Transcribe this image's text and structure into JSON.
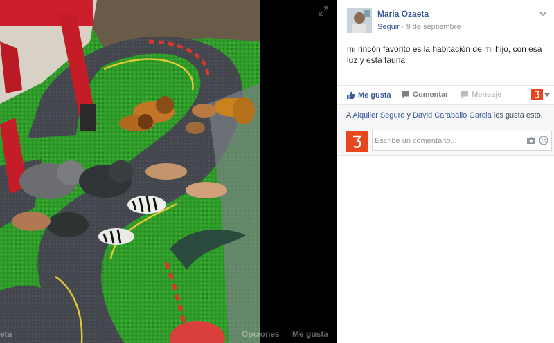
{
  "post": {
    "author": "Maria Ozaeta",
    "follow_label": "Seguir",
    "separator": " · ",
    "date": "9 de septiembre",
    "text": "mi rincón favorito es la habitación de mi hijo, con esa luz y esta fauna"
  },
  "actions": {
    "like": "Me gusta",
    "comment": "Comentar",
    "message": "Mensaje"
  },
  "likes": {
    "prefix": "A ",
    "user1": "Alquiler Seguro",
    "joiner": " y ",
    "user2": "David Caraballo Garcia",
    "suffix": " les gusta esto."
  },
  "comment_box": {
    "placeholder": "Escribe un comentario..."
  },
  "photo_footer": {
    "left_text": "eta",
    "options": "Opciones",
    "like": "Me gusta"
  },
  "icons": {
    "expand": "expand-icon",
    "menu": "chevron-down-icon",
    "like": "thumbs-up-icon",
    "comment": "comment-icon",
    "message": "message-icon",
    "share": "share-brand-icon",
    "camera": "camera-icon",
    "smiley": "smiley-icon"
  },
  "colors": {
    "link": "#3b5998",
    "brand_orange": "#e8461e",
    "panel_bg": "#f6f7f9",
    "text": "#1d2129",
    "muted": "#90949c"
  }
}
